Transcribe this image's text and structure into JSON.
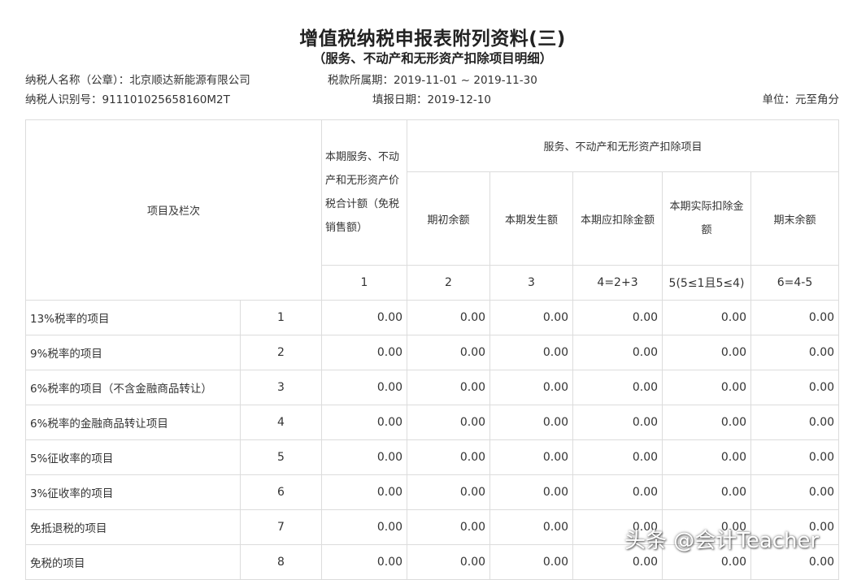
{
  "title": "增值税纳税申报表附列资料(三)",
  "subtitle": "（服务、不动产和无形资产扣除项目明细）",
  "info": {
    "taxpayer_name": "纳税人名称（公章）：北京顺达新能源有限公司",
    "tax_period": "税款所属期：2019-11-01 ~ 2019-11-30",
    "taxpayer_id": "纳税人识别号：911101025658160M2T",
    "fill_date": "填报日期：2019-12-10",
    "unit": "单位：元至角分"
  },
  "table": {
    "header": {
      "item_column": "项目及栏次",
      "col1": "本期服务、不动产和无形资产价税合计额（免税销售额）",
      "group": "服务、不动产和无形资产扣除项目",
      "col2": "期初余额",
      "col3": "本期发生额",
      "col4": "本期应扣除金额",
      "col5": "本期实际扣除金额",
      "col6": "期末余额",
      "formulas": [
        "1",
        "2",
        "3",
        "4=2+3",
        "5(5≤1且5≤4)",
        "6=4-5"
      ]
    },
    "rows": [
      {
        "label": "13%税率的项目",
        "num": "1",
        "values": [
          "0.00",
          "0.00",
          "0.00",
          "0.00",
          "0.00",
          "0.00"
        ]
      },
      {
        "label": "9%税率的项目",
        "num": "2",
        "values": [
          "0.00",
          "0.00",
          "0.00",
          "0.00",
          "0.00",
          "0.00"
        ]
      },
      {
        "label": "6%税率的项目（不含金融商品转让）",
        "num": "3",
        "values": [
          "0.00",
          "0.00",
          "0.00",
          "0.00",
          "0.00",
          "0.00"
        ]
      },
      {
        "label": "6%税率的金融商品转让项目",
        "num": "4",
        "values": [
          "0.00",
          "0.00",
          "0.00",
          "0.00",
          "0.00",
          "0.00"
        ]
      },
      {
        "label": "5%征收率的项目",
        "num": "5",
        "values": [
          "0.00",
          "0.00",
          "0.00",
          "0.00",
          "0.00",
          "0.00"
        ]
      },
      {
        "label": "3%征收率的项目",
        "num": "6",
        "values": [
          "0.00",
          "0.00",
          "0.00",
          "0.00",
          "0.00",
          "0.00"
        ]
      },
      {
        "label": "免抵退税的项目",
        "num": "7",
        "values": [
          "0.00",
          "0.00",
          "0.00",
          "0.00",
          "0.00",
          "0.00"
        ]
      },
      {
        "label": "免税的项目",
        "num": "8",
        "values": [
          "0.00",
          "0.00",
          "0.00",
          "0.00",
          "0.00",
          "0.00"
        ]
      }
    ]
  },
  "watermark": "头条 @会计Teacher"
}
